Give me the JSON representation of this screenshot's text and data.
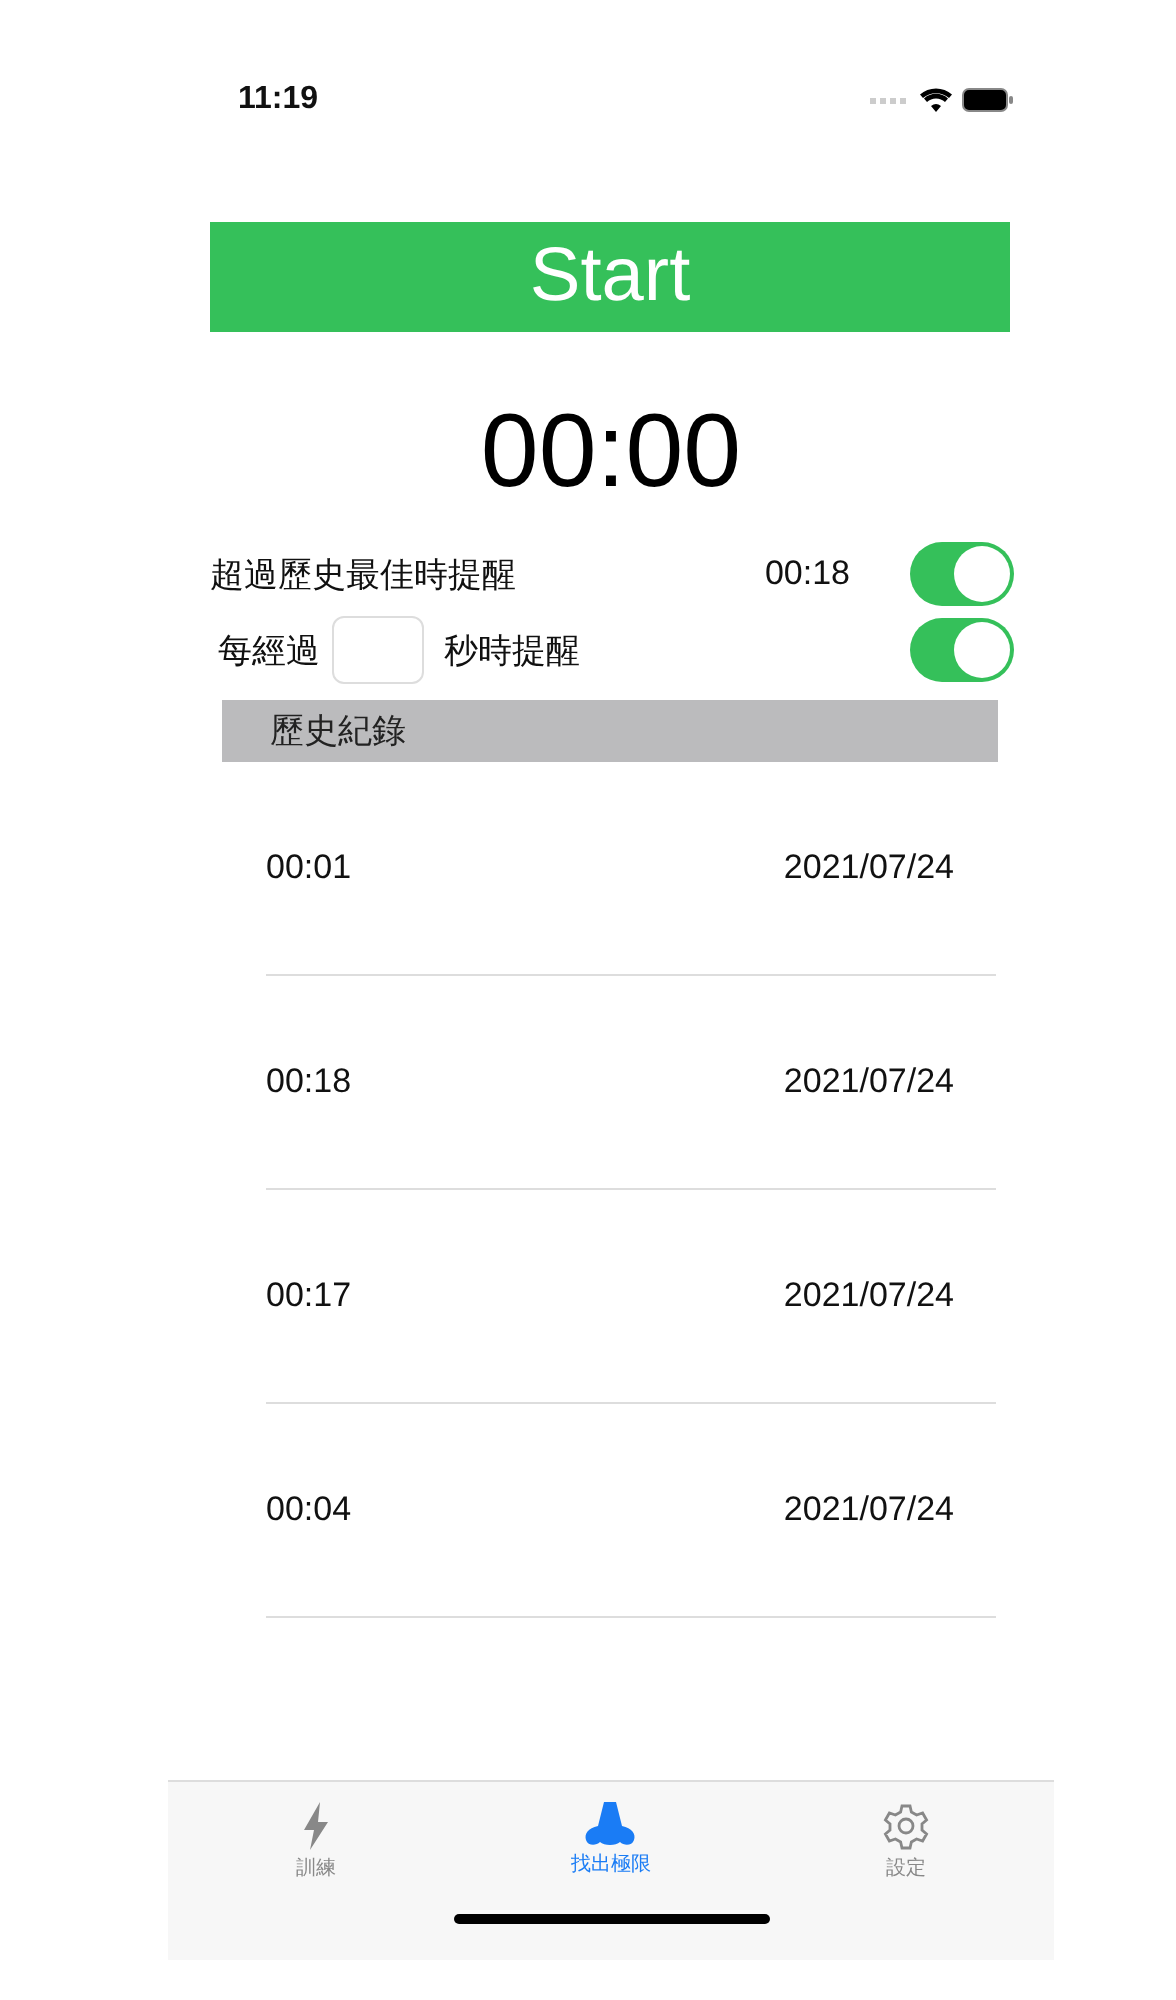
{
  "status_bar": {
    "time": "11:19"
  },
  "start_button": {
    "label": "Start"
  },
  "timer": "00:00",
  "settings": [
    {
      "kind": "best",
      "label": "超過歷史最佳時提醒",
      "value": "00:18",
      "on": true
    },
    {
      "kind": "interval",
      "prefix": "每經過",
      "suffix": "秒時提醒",
      "on": true
    }
  ],
  "history": {
    "header": "歷史紀錄",
    "rows": [
      {
        "time": "00:01",
        "date": "2021/07/24"
      },
      {
        "time": "00:18",
        "date": "2021/07/24"
      },
      {
        "time": "00:17",
        "date": "2021/07/24"
      },
      {
        "time": "00:04",
        "date": "2021/07/24"
      }
    ]
  },
  "tabs": [
    {
      "label": "訓練",
      "kind": "bolt",
      "selected": false
    },
    {
      "label": "找出極限",
      "kind": "nose",
      "selected": true
    },
    {
      "label": "設定",
      "kind": "gear",
      "selected": false
    }
  ]
}
